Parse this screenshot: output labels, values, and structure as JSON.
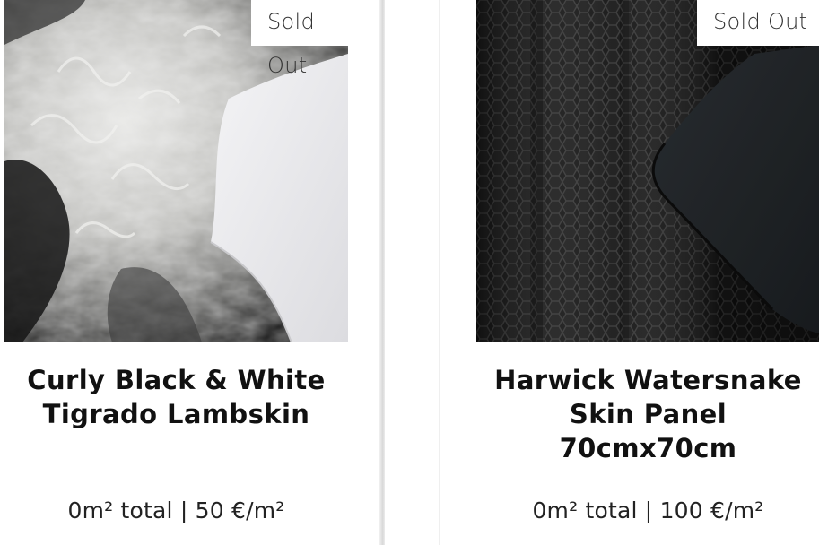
{
  "products": [
    {
      "badge": "Sold Out",
      "title": "Curly Black & White Tigrado Lambskin",
      "price": "0m² total | 50 €/m²",
      "image_icon": "curly-lambskin-photo"
    },
    {
      "badge": "Sold Out",
      "title": "Harwick Watersnake Skin Panel 70cmx70cm",
      "price": "0m² total | 100 €/m²",
      "image_icon": "watersnake-skin-photo"
    }
  ]
}
